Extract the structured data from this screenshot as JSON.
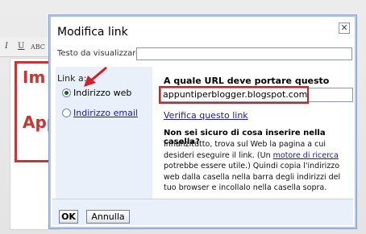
{
  "background": {
    "toolbar_icons": [
      "I",
      "U",
      "ABC"
    ],
    "text_fragments": [
      "Im",
      "App"
    ]
  },
  "dialog": {
    "title": "Modifica link",
    "close_symbol": "✕",
    "display_text_label": "Testo da visualizzare:",
    "display_text_value": "",
    "link_to_label": "Link a:",
    "options": [
      {
        "label": "Indirizzo web",
        "selected": true
      },
      {
        "label": "Indirizzo email",
        "selected": false
      }
    ],
    "url_question": "A quale URL deve portare questo link?",
    "url_value": "appuntiperblogger.blogspot.com",
    "verify_link": "Verifica questo link",
    "help_heading": "Non sei sicuro di cosa inserire nella casella?",
    "help_text_1": "Innanzitutto, trova sul Web la pagina a cui desideri eseguire il link. (Un ",
    "help_link": "motore di ricerca",
    "help_text_2": " potrebbe essere utile.) Quindi copia l'indirizzo web dalla casella nella barra degli indirizzi del tuo browser e incollalo nella casella sopra.",
    "ok_label": "OK",
    "cancel_label": "Annulla"
  },
  "colors": {
    "annotation": "#d0202a",
    "link": "#1a1aa8",
    "panel": "#eaf0fa"
  }
}
